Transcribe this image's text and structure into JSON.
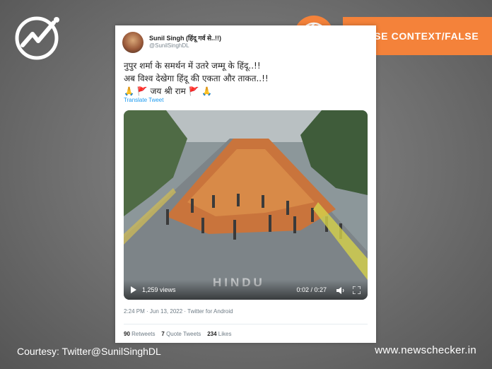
{
  "verdict": "FALSE CONTEXT/FALSE",
  "tweet": {
    "author_name": "Sunil Singh (हिंदू गर्व से..!!)",
    "author_handle": "@SunilSinghDL",
    "line1": "नुपुर शर्मा के समर्थन में उतरे जम्मू के हिंदू..!!",
    "line2": "अब विश्व देखेगा हिंदू की एकता और ताकत..!!",
    "line3": "🙏 🚩 जय श्री राम 🚩 🙏",
    "translate_label": "Translate Tweet",
    "video": {
      "views": "1,259 views",
      "watermark": "HINDU",
      "time": "0:02 / 0:27"
    },
    "timestamp": "2:24 PM · Jun 13, 2022 · Twitter for Android",
    "retweets_count": "90",
    "retweets_label": "Retweets",
    "quotes_count": "7",
    "quotes_label": "Quote Tweets",
    "likes_count": "234",
    "likes_label": "Likes"
  },
  "footer": {
    "courtesy": "Courtesy: Twitter@SunilSinghDL",
    "site": "www.newschecker.in"
  },
  "colors": {
    "accent": "#f4823a",
    "link": "#1d9bf0"
  }
}
